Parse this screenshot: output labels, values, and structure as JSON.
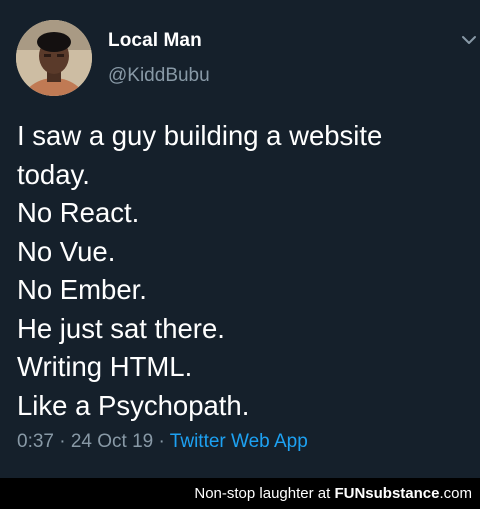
{
  "tweet": {
    "author": {
      "name": "Local Man",
      "handle": "@KiddBubu"
    },
    "menu_icon": "chevron-down-icon",
    "lines": [
      "I saw a guy building a website",
      "today.",
      "No React.",
      "No Vue.",
      "No Ember.",
      "He just sat there.",
      "Writing HTML.",
      "Like a Psychopath."
    ],
    "timestamp": "0:37 · 24 Oct 19 · ",
    "source": "Twitter Web App"
  },
  "footer": {
    "caption": "Non-stop laughter at ",
    "brand_prefix": "FUN",
    "brand_main": "substance",
    "brand_suffix": ".com"
  },
  "colors": {
    "background": "#15202b",
    "secondary_text": "#8899a6",
    "link": "#1da1f2",
    "footer_background": "#000000"
  }
}
